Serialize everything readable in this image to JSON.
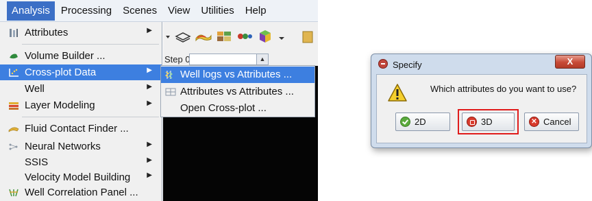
{
  "menubar": {
    "items": [
      {
        "label": "Analysis"
      },
      {
        "label": "Processing"
      },
      {
        "label": "Scenes"
      },
      {
        "label": "View"
      },
      {
        "label": "Utilities"
      },
      {
        "label": "Help"
      }
    ],
    "active_index": 0
  },
  "toolbar": {
    "icons": [
      "dropdown-arrow-icon",
      "layers-icon",
      "surface-icon",
      "volume-blocks-icon",
      "well-log-icon",
      "cube-icon",
      "folder-icon"
    ],
    "step_label": "Step 0"
  },
  "analysis_menu": {
    "items": [
      {
        "label": "Attributes",
        "icon": "attributes-icon",
        "has_submenu": true
      },
      {
        "label": "Volume Builder ...",
        "icon": "volume-builder-icon",
        "has_submenu": false
      },
      {
        "label": "Cross-plot Data",
        "icon": "cross-plot-icon",
        "has_submenu": true,
        "highlighted": true
      },
      {
        "label": "Well",
        "icon": "",
        "has_submenu": true
      },
      {
        "label": "Layer Modeling",
        "icon": "layer-modeling-icon",
        "has_submenu": true
      },
      {
        "label": "Fluid Contact Finder ...",
        "icon": "fluid-contact-icon",
        "has_submenu": false
      },
      {
        "label": "Neural Networks",
        "icon": "neural-network-icon",
        "has_submenu": true
      },
      {
        "label": "SSIS",
        "icon": "",
        "has_submenu": true
      },
      {
        "label": "Velocity Model Building",
        "icon": "",
        "has_submenu": true
      },
      {
        "label": "Well Correlation Panel ...",
        "icon": "well-correlation-icon",
        "has_submenu": false
      }
    ]
  },
  "crossplot_submenu": {
    "items": [
      {
        "label": "Well logs vs Attributes ...",
        "icon": "well-log-icon",
        "highlighted": true
      },
      {
        "label": "Attributes vs Attributes ...",
        "icon": "attributes-grid-icon"
      },
      {
        "label": "Open Cross-plot ...",
        "icon": ""
      }
    ]
  },
  "dialog": {
    "title": "Specify",
    "close_label": "X",
    "message": "Which attributes do you want to use?",
    "buttons": {
      "two_d": "2D",
      "three_d": "3D",
      "cancel": "Cancel"
    },
    "highlighted_button": "3D"
  },
  "colors": {
    "menu_highlight": "#3d7fe0",
    "menubar_active": "#3b6fc6",
    "dialog_frame": "#cfdcec",
    "callout_red": "#e01b1b"
  }
}
